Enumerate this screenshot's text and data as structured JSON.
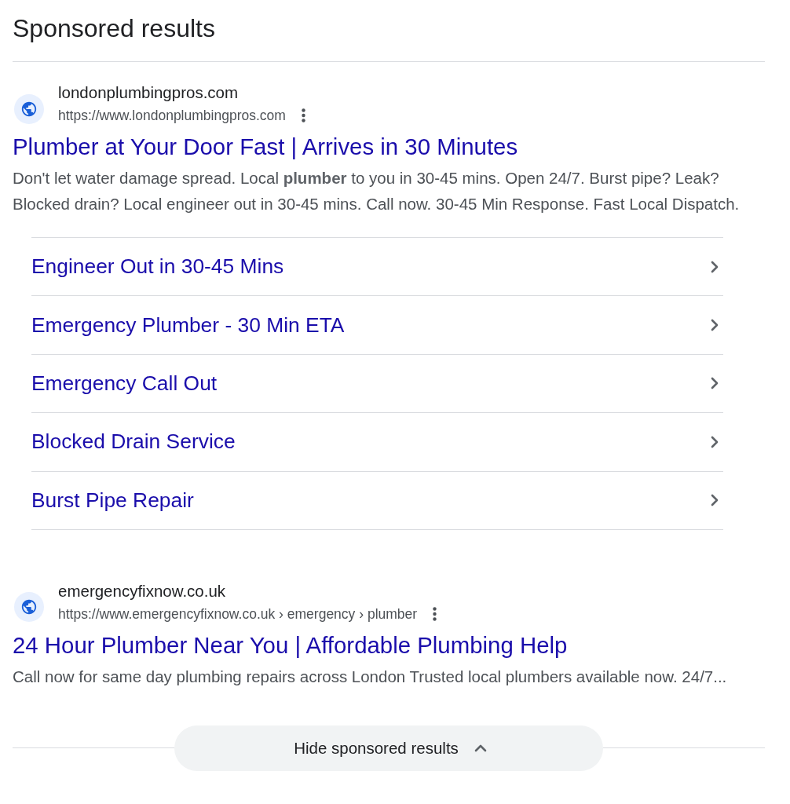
{
  "heading": "Sponsored results",
  "ads": [
    {
      "site_name": "londonplumbingpros.com",
      "url": "https://www.londonplumbingpros.com",
      "title": "Plumber at Your Door Fast | Arrives in 30 Minutes",
      "description": "Don't let water damage spread. Local **plumber** to you in 30-45 mins. Open 24/7. Burst pipe? Leak? Blocked drain? Local engineer out in 30-45 mins. Call now. 30-45 Min Response. Fast Local Dispatch.",
      "sitelinks": [
        "Engineer Out in 30-45 Mins",
        "Emergency Plumber - 30 Min ETA",
        "Emergency Call Out",
        "Blocked Drain Service",
        "Burst Pipe Repair"
      ]
    },
    {
      "site_name": "emergencyfixnow.co.uk",
      "url": "https://www.emergencyfixnow.co.uk › emergency › plumber",
      "title": "24 Hour Plumber Near You | Affordable Plumbing Help",
      "description": "Call now for same day plumbing repairs across London Trusted local plumbers available now. 24/7..."
    }
  ],
  "toggle_button": {
    "label": "Hide sponsored results"
  }
}
